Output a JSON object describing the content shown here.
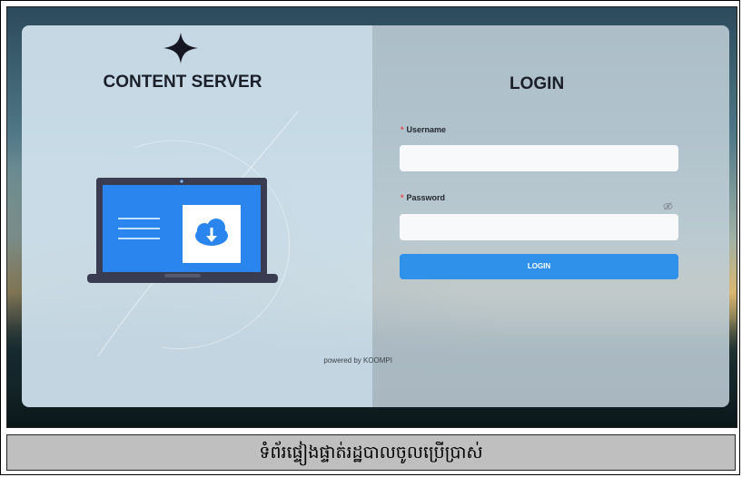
{
  "brand": {
    "title": "CONTENT SERVER",
    "logo_icon": "four-point-star-icon",
    "illustration_icon": "laptop-cloud-download-icon"
  },
  "login": {
    "title": "LOGIN",
    "username_label": "Username",
    "password_label": "Password",
    "required_marker": "*",
    "username_value": "",
    "password_value": "",
    "password_toggle_icon": "eye-off-icon",
    "button_label": "LOGIN"
  },
  "footer": {
    "powered_by": "powered by KOOMPI"
  },
  "caption": "ទំព័រផ្ទៀងផ្ទាត់រដ្ឋបាលចូលប្រើប្រាស់",
  "colors": {
    "accent": "#2f91ea",
    "laptop_screen": "#2a86ee",
    "laptop_frame": "#3a3c52",
    "required": "#e5484d"
  }
}
